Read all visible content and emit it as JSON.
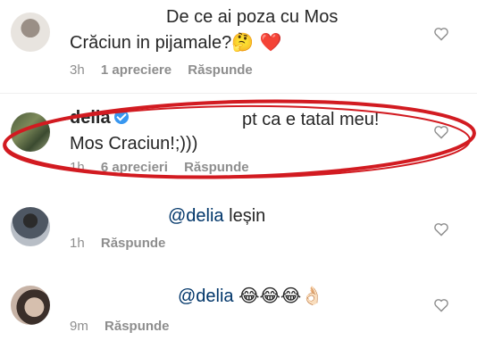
{
  "comments": [
    {
      "text_line1": "De ce ai poza cu Mos",
      "text_line2": "Crăciun in pijamale?",
      "emoji": "🤔 ❤️",
      "time": "3h",
      "likes": "1 apreciere",
      "reply": "Răspunde"
    },
    {
      "username": "delia",
      "text_line1": "pt ca e tatal meu!",
      "text_line2": "Mos Craciun!;)))",
      "time": "1h",
      "likes": "6 aprecieri",
      "reply": "Răspunde"
    },
    {
      "mention": "@delia",
      "text": "leșin",
      "time": "1h",
      "reply": "Răspunde"
    },
    {
      "mention": "@delia",
      "emoji": "😂😂😂👌🏻",
      "time": "9m",
      "reply": "Răspunde"
    }
  ],
  "colors": {
    "annotation_ellipse": "#d21b21",
    "verified": "#3897f0"
  }
}
